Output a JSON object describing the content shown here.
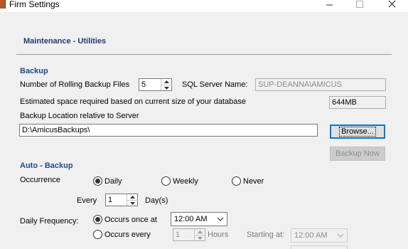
{
  "window": {
    "title": "Firm Settings"
  },
  "page": {
    "heading": "Maintenance - Utilities"
  },
  "backup": {
    "section_title": "Backup",
    "rolling_files_label": "Number of Rolling Backup Files",
    "rolling_files_value": "5",
    "sql_server_label": "SQL Server Name:",
    "sql_server_value": "SUP-DEANNA\\AMICUS",
    "space_label": "Estimated space required based on current size of your database",
    "space_value": "644MB",
    "location_label": "Backup Location relative to Server",
    "location_value": "D:\\AmicusBackups\\",
    "browse_label": "Browse...",
    "backup_now_label": "Backup Now"
  },
  "auto_backup": {
    "section_title": "Auto - Backup",
    "occurrence_label": "Occurrence",
    "options": {
      "daily": "Daily",
      "weekly": "Weekly",
      "never": "Never"
    },
    "selected_occurrence": "daily",
    "every_label": "Every",
    "every_value": "1",
    "days_label": "Day(s)",
    "daily_frequency_label": "Daily Frequency:",
    "occurs_once_label": "Occurs once at",
    "occurs_once_time": "12:00 AM",
    "occurs_every_label": "Occurs every",
    "occurs_every_value": "1",
    "hours_label": "Hours",
    "starting_at_label": "Starting at:",
    "starting_at_value": "12:00 AM",
    "frequency_selected": "once"
  }
}
